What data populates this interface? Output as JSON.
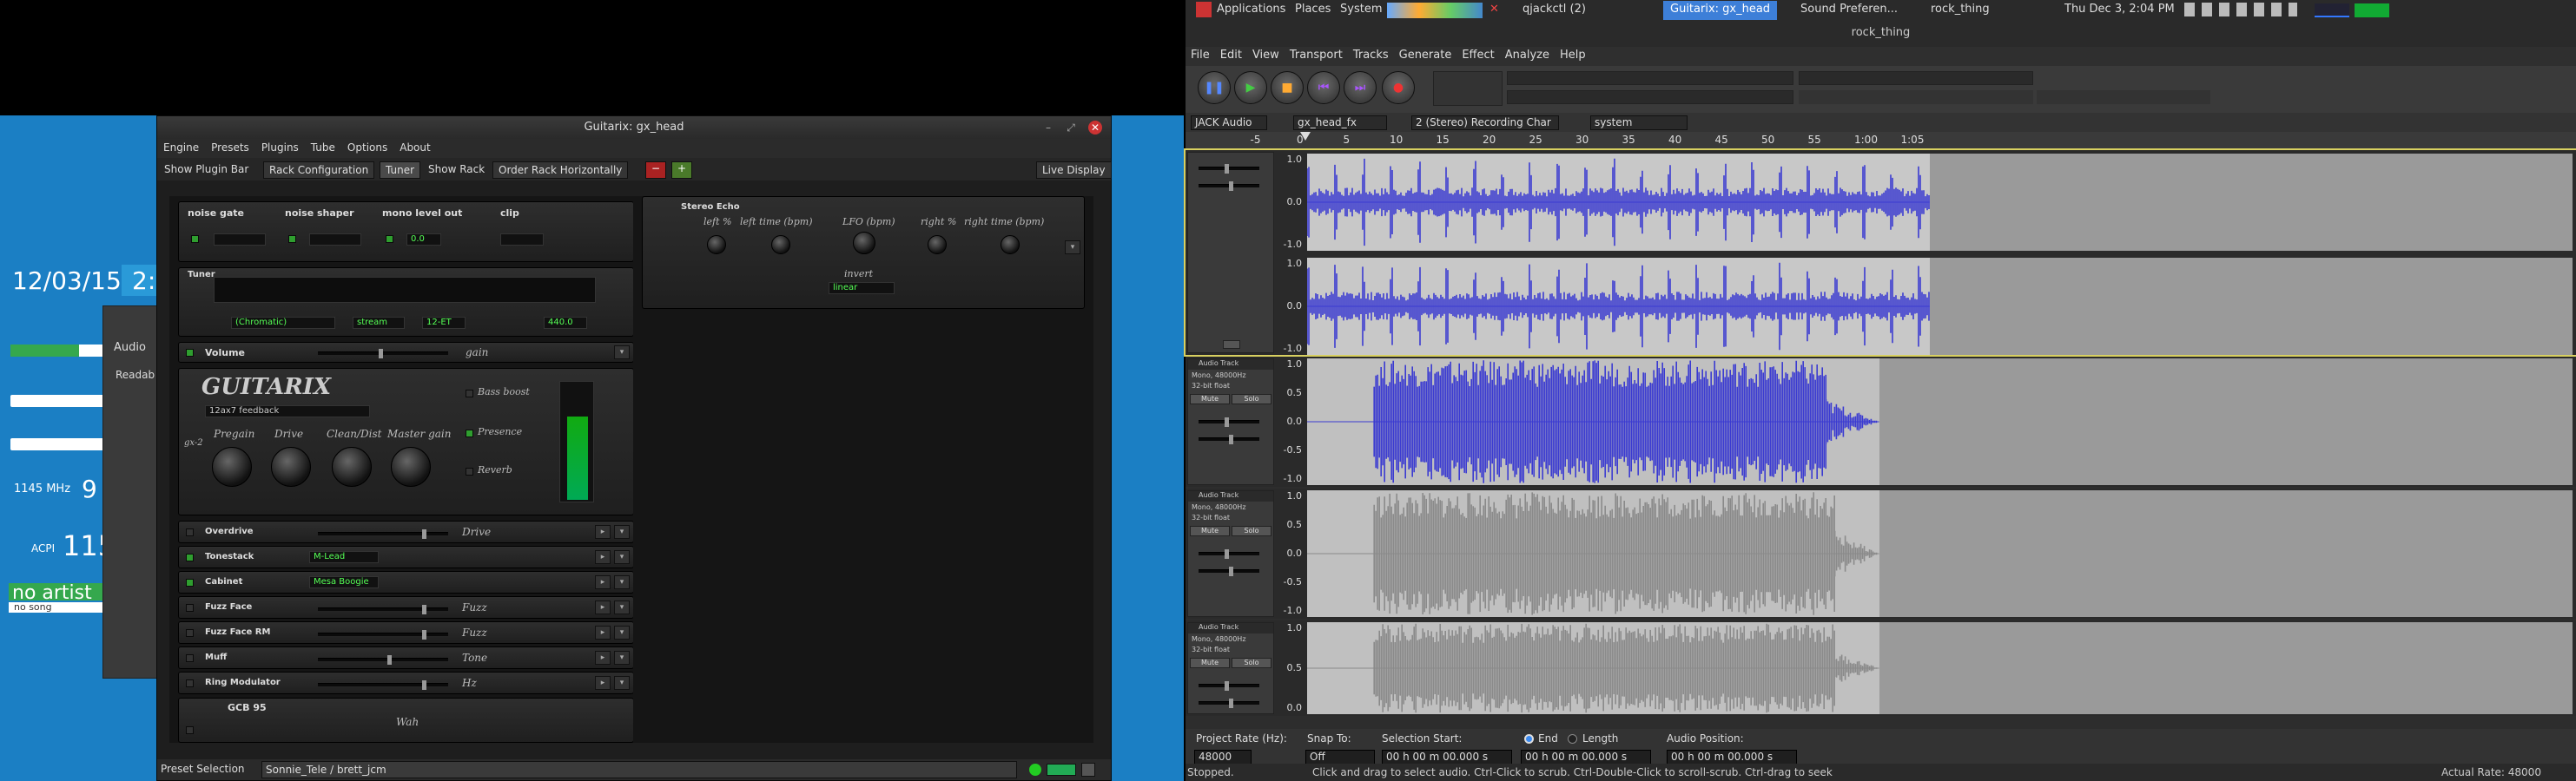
{
  "conky": {
    "date": "12/03/15",
    "time": "2:0",
    "freq": "1145 MHz",
    "freq_big": "9",
    "acpi_label": "ACPI",
    "acpi_value": "115",
    "artist": "no artist",
    "song": "no song",
    "bars": [
      0.72,
      0.0,
      0.0
    ]
  },
  "audio_dialog": {
    "title": "Audio",
    "readable": "Readab"
  },
  "guitarix": {
    "title": "Guitarix: gx_head",
    "menu": [
      "Engine",
      "Presets",
      "Plugins",
      "Tube",
      "Options",
      "About"
    ],
    "toolbar": {
      "show_plugin_bar": "Show Plugin Bar",
      "rack_config": "Rack Configuration",
      "tuner": "Tuner",
      "show_rack": "Show Rack",
      "order_rack": "Order Rack Horizontally",
      "live_display": "Live Display"
    },
    "mono_header": {
      "labels": [
        "noise gate",
        "noise shaper",
        "mono level out",
        "clip"
      ],
      "level_value": "0.0"
    },
    "tuner": {
      "title": "Tuner",
      "mode": "(Chromatic)",
      "stream": "stream",
      "temperament": "12-ET",
      "freq": "440.0"
    },
    "volume": {
      "label": "Volume",
      "param": "gain"
    },
    "amp": {
      "logo": "GUITARIX",
      "model": "12ax7 feedback",
      "tube_label": "gx-2",
      "knobs": [
        "Pregain",
        "Drive",
        "Clean/Dist",
        "Master gain"
      ],
      "switches": [
        "Bass boost",
        "Presence",
        "Reverb"
      ]
    },
    "plugins": [
      {
        "name": "Overdrive",
        "param": "Drive",
        "on": false
      },
      {
        "name": "Tonestack",
        "combo": "M-Lead",
        "on": true
      },
      {
        "name": "Cabinet",
        "combo": "Mesa Boogie",
        "on": true
      },
      {
        "name": "Fuzz Face",
        "param": "Fuzz",
        "on": false
      },
      {
        "name": "Fuzz Face RM",
        "param": "Fuzz",
        "on": false
      },
      {
        "name": "Muff",
        "param": "Tone",
        "on": false
      },
      {
        "name": "Ring Modulator",
        "param": "Hz",
        "on": false
      }
    ],
    "gcb": {
      "name": "GCB 95",
      "param": "Wah"
    },
    "stereo_echo": {
      "title": "Stereo Echo",
      "knobs": [
        "left %",
        "left time (bpm)",
        "LFO (bpm)",
        "right %",
        "right time (bpm)"
      ],
      "invert_label": "invert",
      "invert_value": "linear"
    },
    "preset_bar": {
      "label": "Preset Selection",
      "value": "Sonnie_Tele / brett_jcm"
    }
  },
  "panel": {
    "applications": "Applications",
    "places": "Places",
    "system": "System",
    "tasks": [
      {
        "label": "qjackctl (2)",
        "active": false
      },
      {
        "label": "Guitarix: gx_head",
        "active": true
      },
      {
        "label": "Sound Preferen...",
        "active": false
      },
      {
        "label": "rock_thing",
        "active": false
      }
    ],
    "clock": "Thu Dec 3, 2:04 PM"
  },
  "audacity": {
    "title": "rock_thing",
    "menu": [
      "File",
      "Edit",
      "View",
      "Transport",
      "Tracks",
      "Generate",
      "Effect",
      "Analyze",
      "Help"
    ],
    "device": {
      "host": "JACK Audio",
      "input": "gx_head_fx",
      "channels": "2 (Stereo) Recording Char",
      "output": "system"
    },
    "ruler": [
      {
        "t": -5,
        "label": "-5"
      },
      {
        "t": 0,
        "label": "0"
      },
      {
        "t": 5,
        "label": "5"
      },
      {
        "t": 10,
        "label": "10"
      },
      {
        "t": 15,
        "label": "15"
      },
      {
        "t": 20,
        "label": "20"
      },
      {
        "t": 25,
        "label": "25"
      },
      {
        "t": 30,
        "label": "30"
      },
      {
        "t": 35,
        "label": "35"
      },
      {
        "t": 40,
        "label": "40"
      },
      {
        "t": 45,
        "label": "45"
      },
      {
        "t": 50,
        "label": "50"
      },
      {
        "t": 55,
        "label": "55"
      },
      {
        "t": 60,
        "label": "1:00"
      },
      {
        "t": 65,
        "label": "1:05"
      }
    ],
    "tracks": [
      {
        "name": "",
        "info": "",
        "scale": [
          "1.0",
          "0.0",
          "-1.0"
        ],
        "stereo": true,
        "selected": true
      },
      {
        "name": "Audio Track",
        "info": "Mono, 48000Hz",
        "format": "32-bit float",
        "mute": "Mute",
        "solo": "Solo",
        "scale": [
          "1.0",
          "0.5",
          "0.0",
          "-0.5",
          "-1.0"
        ]
      },
      {
        "name": "Audio Track",
        "info": "Mono, 48000Hz",
        "format": "32-bit float",
        "mute": "Mute",
        "solo": "Solo",
        "scale": [
          "1.0",
          "0.5",
          "0.0",
          "-0.5",
          "-1.0"
        ]
      },
      {
        "name": "Audio Track",
        "info": "Mono, 48000Hz",
        "format": "32-bit float",
        "mute": "Mute",
        "solo": "Solo",
        "scale": [
          "1.0",
          "0.5",
          "0.0"
        ]
      }
    ],
    "selection": {
      "project_rate_label": "Project Rate (Hz):",
      "project_rate": "48000",
      "snap_label": "Snap To:",
      "snap": "Off",
      "sel_start_label": "Selection Start:",
      "end_label": "End",
      "length_label": "Length",
      "audio_pos_label": "Audio Position:",
      "start": "00 h 00 m 00.000 s",
      "end": "00 h 00 m 00.000 s",
      "pos": "00 h 00 m 00.000 s"
    },
    "status": {
      "state": "Stopped.",
      "hint": "Click and drag to select audio. Ctrl-Click to scrub. Ctrl-Double-Click to scroll-scrub. Ctrl-drag to seek",
      "actual_rate": "Actual Rate: 48000"
    }
  }
}
